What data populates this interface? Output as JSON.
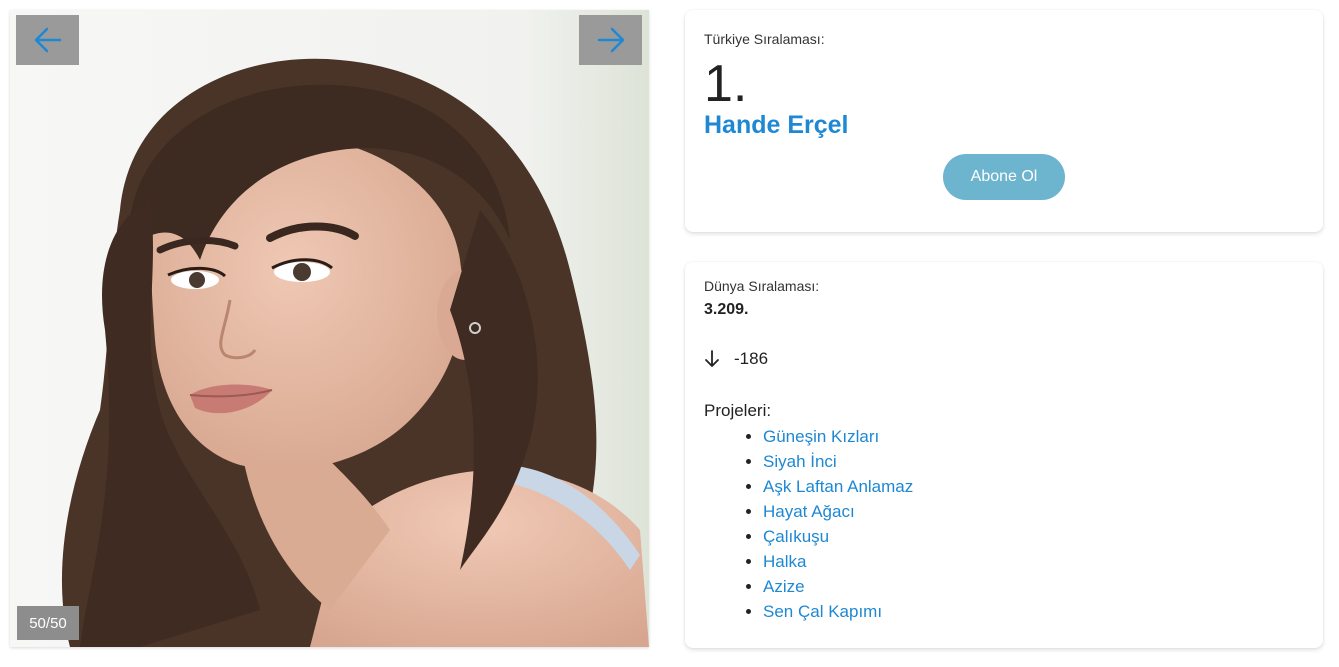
{
  "gallery": {
    "counter": "50/50",
    "prev_icon": "arrow-left-icon",
    "next_icon": "arrow-right-icon",
    "arrow_color": "#1e88d3"
  },
  "ranking": {
    "turkey_label": "Türkiye Sıralaması:",
    "turkey_rank": "1.",
    "name": "Hande Erçel",
    "subscribe_label": "Abone Ol"
  },
  "world": {
    "label": "Dünya Sıralaması:",
    "rank": "3.209.",
    "change_icon": "arrow-down-icon",
    "change": "-186"
  },
  "projects": {
    "title": "Projeleri:",
    "items": [
      "Güneşin Kızları",
      "Siyah İnci",
      "Aşk Laftan Anlamaz",
      "Hayat Ağacı",
      "Çalıkuşu",
      "Halka",
      "Azize",
      "Sen Çal Kapımı"
    ]
  },
  "colors": {
    "link": "#1e88d3",
    "button": "#6db4cf",
    "nav_bg": "#9a9a9a"
  }
}
